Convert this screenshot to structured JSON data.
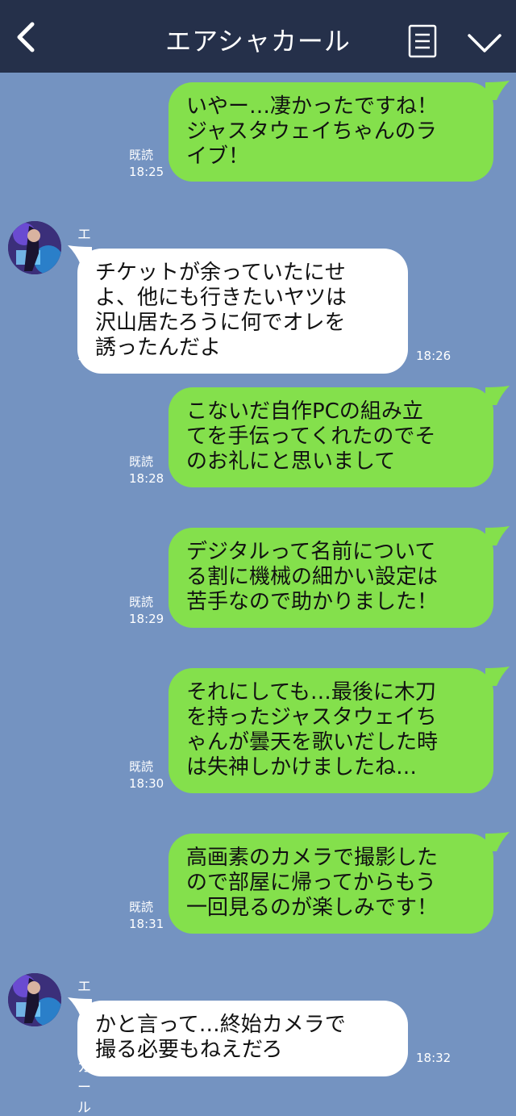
{
  "header": {
    "title": "エアシャカール"
  },
  "sender_name": "エアシャカール",
  "read_label": "既読",
  "messages": [
    {
      "from": "me",
      "text": "いやー…凄かったですね！\nジャスタウェイちゃんのラ\nイブ！",
      "time": "18:25",
      "read": true
    },
    {
      "from": "them",
      "text": "チケットが余っていたにせ\nよ、他にも行きたいヤツは\n沢山居たろうに何でオレを\n誘ったんだよ",
      "time": "18:26"
    },
    {
      "from": "me",
      "text": "こないだ自作PCの組み立\nてを手伝ってくれたのでそ\nのお礼にと思いまして",
      "time": "18:28",
      "read": true
    },
    {
      "from": "me",
      "text": "デジタルって名前について\nる割に機械の細かい設定は\n苦手なので助かりました！",
      "time": "18:29",
      "read": true
    },
    {
      "from": "me",
      "text": "それにしても…最後に木刀\nを持ったジャスタウェイち\nゃんが曇天を歌いだした時\nは失神しかけましたね…",
      "time": "18:30",
      "read": true
    },
    {
      "from": "me",
      "text": "高画素のカメラで撮影した\nので部屋に帰ってからもう\n一回見るのが楽しみです！",
      "time": "18:31",
      "read": true
    },
    {
      "from": "them",
      "text": "かと言って…終始カメラで\n撮る必要もねえだろ",
      "time": "18:32"
    }
  ],
  "colors": {
    "header": "#25304a",
    "background": "#7493c1",
    "my_bubble": "#84e04c",
    "their_bubble": "#ffffff"
  },
  "icons": {
    "back": "chevron-left-icon",
    "menu": "menu-list-icon",
    "options": "chevron-down-icon"
  }
}
